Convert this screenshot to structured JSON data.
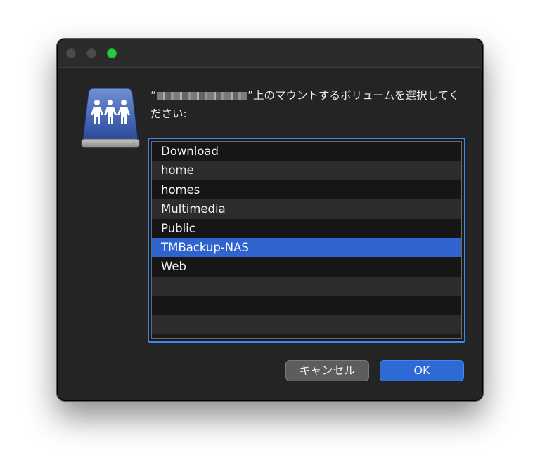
{
  "dialog": {
    "prompt_open_quote": "“",
    "prompt_text": "”上のマウントするボリュームを選択してください:",
    "volumes": [
      {
        "label": "Download",
        "selected": false
      },
      {
        "label": "home",
        "selected": false
      },
      {
        "label": "homes",
        "selected": false
      },
      {
        "label": "Multimedia",
        "selected": false
      },
      {
        "label": "Public",
        "selected": false
      },
      {
        "label": "TMBackup-NAS",
        "selected": true
      },
      {
        "label": "Web",
        "selected": false
      }
    ],
    "cancel_label": "キャンセル",
    "ok_label": "OK"
  },
  "icons": {
    "volume": "shared-volume-icon",
    "close": "close-icon",
    "minimize": "minimize-icon",
    "zoom": "zoom-icon"
  },
  "colors": {
    "selection": "#2f64cf",
    "accent": "#3f87f0",
    "zoom_button": "#2ac840"
  }
}
